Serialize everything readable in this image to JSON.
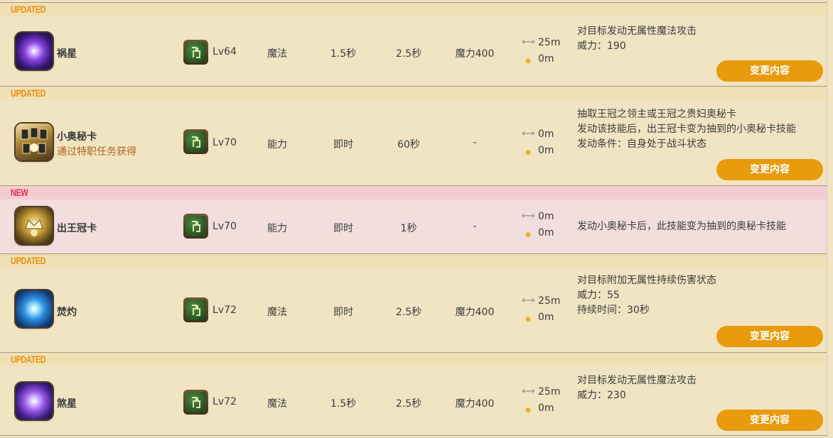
{
  "colors": {
    "page_bg": "#f1e4c3",
    "tag_bar_bg": "#f0e0b5",
    "new_row_bg": "#f1dedd",
    "new_tag_bar_bg": "#f1cdd1",
    "updated_tag": "#e98f0f",
    "new_tag": "#e0304a",
    "button_bg": "#e79b0d",
    "button_text": "#ffffff"
  },
  "skills": [
    {
      "tag": "UPDATED",
      "icon": "gravity-purple-orb-icon",
      "name": "祸星",
      "subtitle": "",
      "class_icon": "astrologian-job-icon",
      "level": "Lv64",
      "type": "魔法",
      "cast": "1.5秒",
      "recast": "2.5秒",
      "cost": "魔力400",
      "range": "25m",
      "radius": "0m",
      "description": [
        "对目标发动无属性魔法攻击",
        "威力：190"
      ],
      "button": "变更内容"
    },
    {
      "tag": "UPDATED",
      "icon": "minor-arcana-card-icon",
      "name": "小奥秘卡",
      "subtitle": "通过特职任务获得",
      "class_icon": "astrologian-job-icon",
      "level": "Lv70",
      "type": "能力",
      "cast": "即时",
      "recast": "60秒",
      "cost": "-",
      "range": "0m",
      "radius": "0m",
      "description": [
        "抽取王冠之领主或王冠之贵妇奥秘卡",
        "发动该技能后，出王冠卡变为抽到的小奥秘卡技能",
        "发动条件：自身处于战斗状态"
      ],
      "button": "变更内容"
    },
    {
      "tag": "NEW",
      "icon": "crown-play-card-icon",
      "name": "出王冠卡",
      "subtitle": "",
      "class_icon": "astrologian-job-icon",
      "level": "Lv70",
      "type": "能力",
      "cast": "即时",
      "recast": "1秒",
      "cost": "-",
      "range": "0m",
      "radius": "0m",
      "description": [
        "发动小奥秘卡后，此技能变为抽到的奥秘卡技能"
      ],
      "button": ""
    },
    {
      "tag": "UPDATED",
      "icon": "combust-blue-star-icon",
      "name": "焚灼",
      "subtitle": "",
      "class_icon": "astrologian-job-icon",
      "level": "Lv72",
      "type": "魔法",
      "cast": "即时",
      "recast": "2.5秒",
      "cost": "魔力400",
      "range": "25m",
      "radius": "0m",
      "description": [
        "对目标附加无属性持续伤害状态",
        "威力：55",
        "持续时间：30秒"
      ],
      "button": "变更内容"
    },
    {
      "tag": "UPDATED",
      "icon": "fall-malefic-orb-icon",
      "name": "煞星",
      "subtitle": "",
      "class_icon": "astrologian-job-icon",
      "level": "Lv72",
      "type": "魔法",
      "cast": "1.5秒",
      "recast": "2.5秒",
      "cost": "魔力400",
      "range": "25m",
      "radius": "0m",
      "description": [
        "对目标发动无属性魔法攻击",
        "威力：230"
      ],
      "button": "变更内容"
    }
  ]
}
